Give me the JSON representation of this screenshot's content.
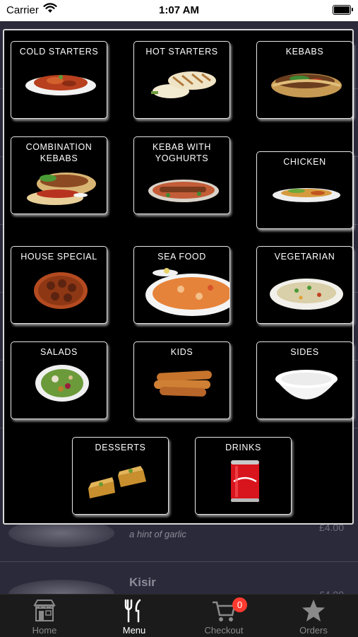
{
  "status_bar": {
    "carrier": "Carrier",
    "time": "1:07 AM"
  },
  "background_list": {
    "items": [
      {
        "name": "",
        "description": "a hint of garlic",
        "price": "£4.00"
      },
      {
        "name": "Kisir",
        "description": "",
        "price": "£4.00"
      }
    ]
  },
  "menu_categories": [
    {
      "label": "COLD STARTERS"
    },
    {
      "label": "HOT STARTERS"
    },
    {
      "label": "KEBABS"
    },
    {
      "label_lines": [
        "COMBINATION",
        "KEBABS"
      ]
    },
    {
      "label_lines": [
        "KEBAB WITH",
        "YOGHURTS"
      ]
    },
    {
      "label": "CHICKEN"
    },
    {
      "label": "HOUSE SPECIAL"
    },
    {
      "label": "SEA FOOD"
    },
    {
      "label": "VEGETARIAN"
    },
    {
      "label": "SALADS"
    },
    {
      "label": "KIDS"
    },
    {
      "label": "SIDES"
    },
    {
      "label": "DESSERTS"
    },
    {
      "label": "DRINKS"
    }
  ],
  "tab_bar": {
    "tabs": [
      {
        "label": "Home",
        "icon": "store-icon"
      },
      {
        "label": "Menu",
        "icon": "fork-knife-icon",
        "active": true
      },
      {
        "label": "Checkout",
        "icon": "cart-icon",
        "badge": "0"
      },
      {
        "label": "Orders",
        "icon": "star-icon"
      }
    ]
  },
  "colors": {
    "background": "#2b2a3a",
    "modal": "#000000",
    "tab_active": "#ffffff",
    "tab_inactive": "#8a8a8a",
    "badge": "#ff3b30"
  }
}
